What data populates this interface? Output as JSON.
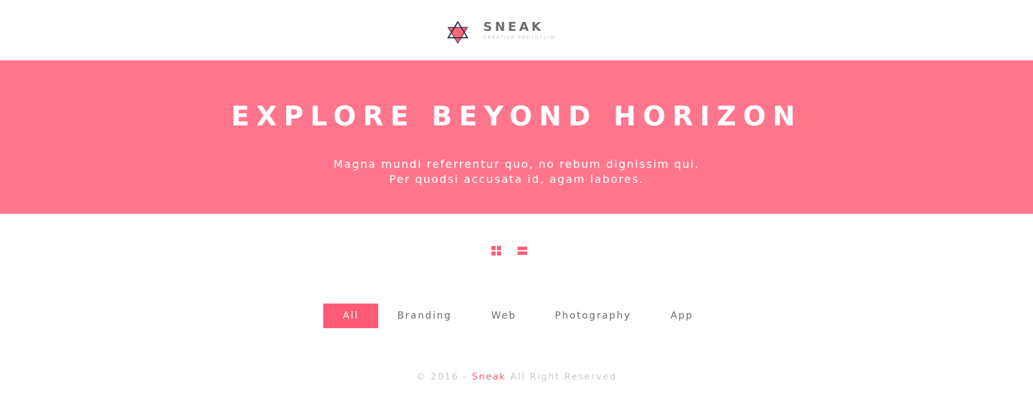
{
  "header": {
    "logo": {
      "icon": "star-of-david-logo-icon",
      "name": "SNEAK",
      "tagline": "CREATIVE PORTOFLIO"
    }
  },
  "hero": {
    "title": "EXPLORE BEYOND HORIZON",
    "subtitle_line1": "Magna mundi referrentur quo, no rebum dignissim qui.",
    "subtitle_line2": "Per quodsi accusata id, agam labores."
  },
  "view_toggle": {
    "grid_icon": "grid-view-icon",
    "list_icon": "list-view-icon"
  },
  "filters": [
    {
      "label": "All",
      "active": true
    },
    {
      "label": "Branding",
      "active": false
    },
    {
      "label": "Web",
      "active": false
    },
    {
      "label": "Photography",
      "active": false
    },
    {
      "label": "App",
      "active": false
    }
  ],
  "footer": {
    "prefix": "© 2016 - ",
    "brand": "Sneak",
    "suffix": " All Right Reserved"
  },
  "colors": {
    "accent": "#ff5b77",
    "hero_bg": "#ff768c",
    "text_gray": "#6b6b6b",
    "muted": "#c3cad6",
    "logo_dark": "#2b2f3f"
  }
}
